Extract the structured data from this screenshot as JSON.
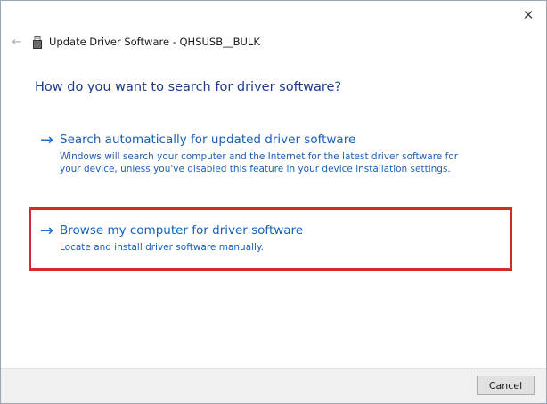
{
  "window": {
    "title": "Update Driver Software - QHSUSB__BULK",
    "close_glyph": "✕",
    "back_glyph": "←"
  },
  "heading": "How do you want to search for driver software?",
  "options": [
    {
      "icon": "right-arrow-icon",
      "glyph": "→",
      "title": "Search automatically for updated driver software",
      "description": "Windows will search your computer and the Internet for the latest driver software for your device, unless you've disabled this feature in your device installation settings."
    },
    {
      "icon": "right-arrow-icon",
      "glyph": "→",
      "title": "Browse my computer for driver software",
      "description": "Locate and install driver software manually."
    }
  ],
  "footer": {
    "cancel_label": "Cancel"
  },
  "colors": {
    "accent": "#1a5fb4",
    "heading": "#1e3a8a",
    "highlight": "#d62a2a"
  }
}
